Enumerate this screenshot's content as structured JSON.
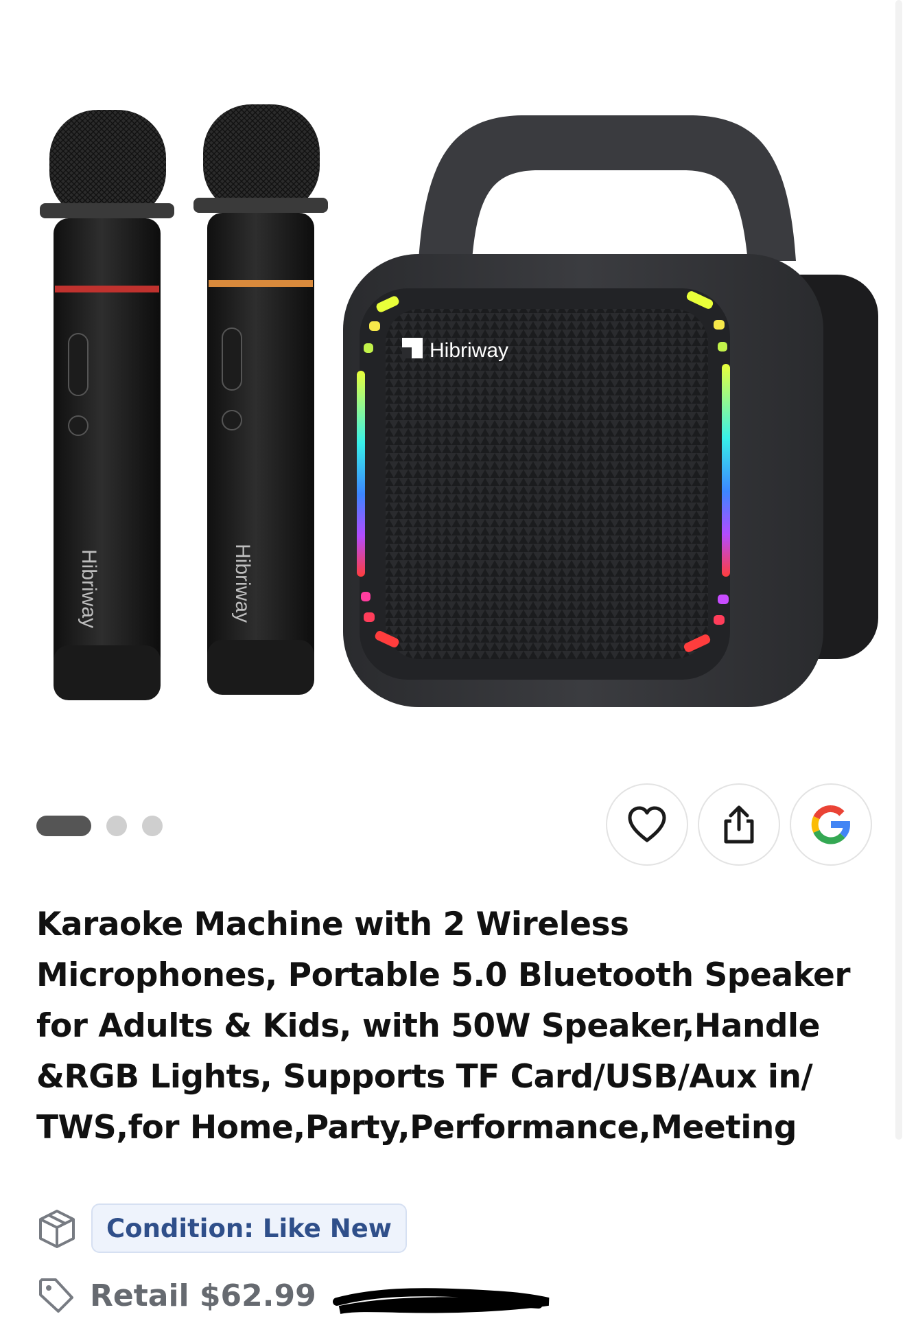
{
  "product": {
    "title": "Karaoke Machine with 2 Wireless Microphones, Portable 5.0 Bluetooth Speaker for Adults & Kids, with 50W Speaker,Handle &RGB Lights, Supports TF Card/USB/Aux in/ TWS,for Home,Party,Performance,Meeting",
    "brand_on_image": "Hibriway",
    "condition_label": "Condition: Like New",
    "retail_label": "Retail $62.99"
  },
  "carousel": {
    "count": 3,
    "active_index": 0
  },
  "actions": {
    "favorite_icon": "heart-icon",
    "share_icon": "share-icon",
    "search_icon": "google-icon"
  },
  "icons": {
    "condition": "box-icon",
    "retail": "tag-icon"
  },
  "colors": {
    "condition_badge_bg": "#eef3fc",
    "condition_badge_text": "#2f4f8a",
    "dot_active": "#555555",
    "dot_inactive": "#cfcfcf"
  }
}
